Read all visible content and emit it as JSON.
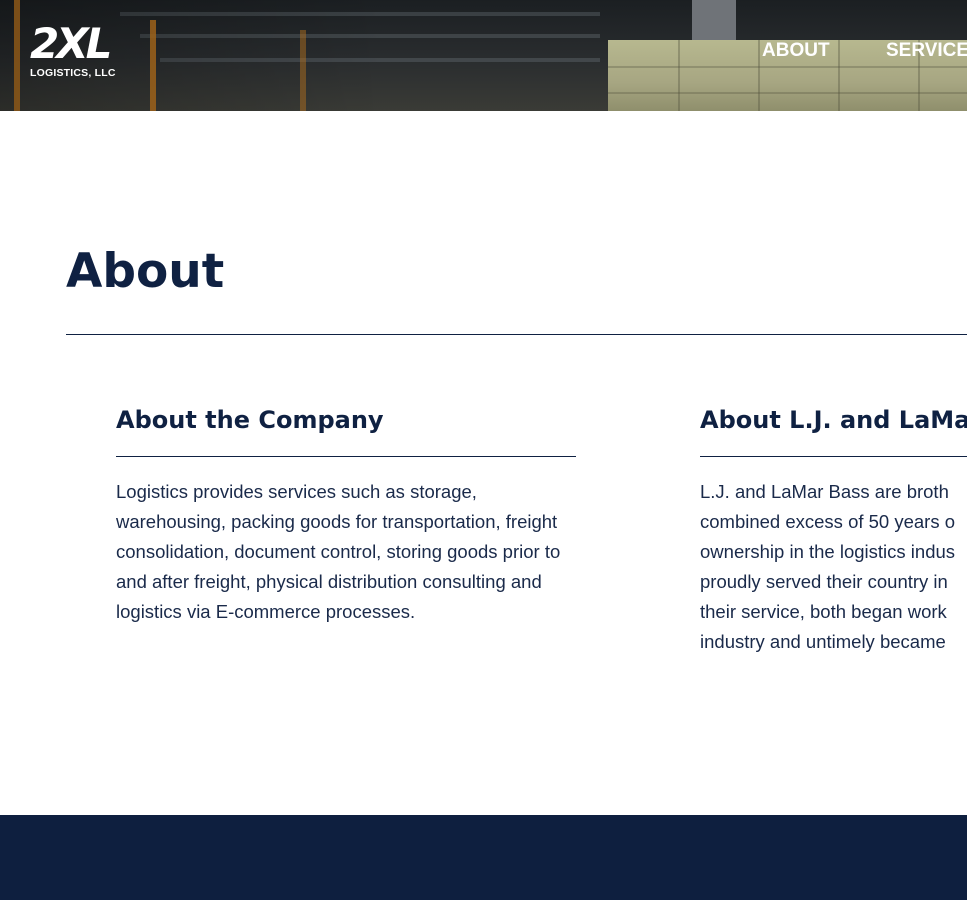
{
  "header": {
    "logo": {
      "mark": "2XL",
      "subtitle": "LOGISTICS, LLC"
    },
    "nav": [
      {
        "label": "ABOUT"
      },
      {
        "label": "SERVICE"
      }
    ]
  },
  "main": {
    "title": "About",
    "columns": [
      {
        "title": "About the Company",
        "lines": [
          "Logistics provides services such as storage,",
          "warehousing, packing goods for transportation, freight",
          "consolidation, document control, storing goods prior to",
          "and after freight, physical distribution consulting and",
          "logistics via E-commerce processes."
        ]
      },
      {
        "title": "About L.J. and LaMar",
        "lines": [
          "L.J. and LaMar Bass are broth",
          "combined excess of 50 years o",
          "ownership in the logistics indus",
          "proudly served their country in",
          "their service, both began work",
          "industry and untimely became"
        ]
      }
    ]
  },
  "colors": {
    "navy": "#0f2142",
    "footer": "#0e1f3f",
    "body_text": "#1a2a4a"
  }
}
